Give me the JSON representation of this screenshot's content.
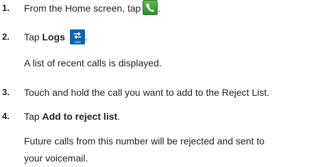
{
  "steps": [
    {
      "number": "1.",
      "text_before": "From the Home screen, tap",
      "text_after": ".",
      "icon": "phone-icon"
    },
    {
      "number": "2.",
      "text_before": "Tap ",
      "bold": "Logs",
      "text_after": ".",
      "icon": "logs-icon",
      "icon_caption": "Logs",
      "note": "A list of recent calls is displayed."
    },
    {
      "number": "3.",
      "text": "Touch and hold the call you want to add to the Reject List."
    },
    {
      "number": "4.",
      "text_before": "Tap ",
      "bold": "Add to reject list",
      "text_after": ".",
      "note_line1": "Future calls from this number will be rejected and sent to",
      "note_line2": "your voicemail."
    }
  ],
  "colors": {
    "text": "#231f20",
    "phone_icon_bg": "#3d9a35",
    "logs_icon_bg": "#0d64ad"
  }
}
